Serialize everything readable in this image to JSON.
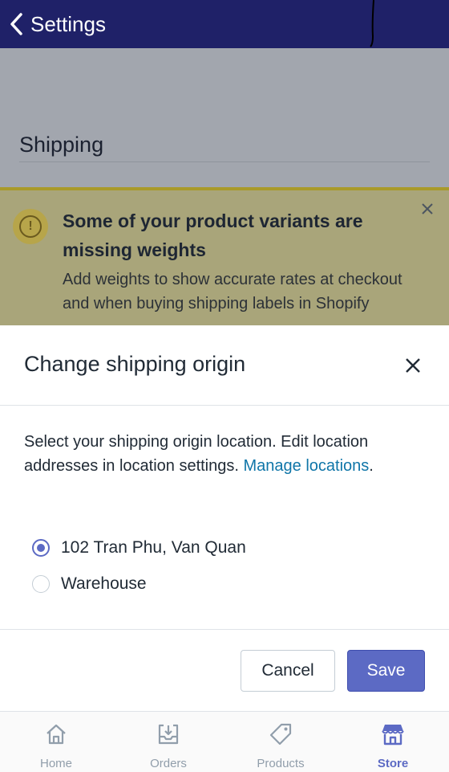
{
  "topbar": {
    "back_label": "Settings"
  },
  "page": {
    "title": "Shipping"
  },
  "banner": {
    "title": "Some of your product variants are missing weights",
    "text": "Add weights to show accurate rates at checkout and when buying shipping labels in Shopify",
    "icon": "warning-icon"
  },
  "sheet": {
    "title": "Change shipping origin",
    "description_prefix": "Select your shipping origin location. Edit location addresses in location settings. ",
    "link_text": "Manage locations",
    "description_suffix": ".",
    "options": [
      {
        "label": "102 Tran Phu, Van Quan",
        "selected": true
      },
      {
        "label": "Warehouse",
        "selected": false
      }
    ],
    "cancel_label": "Cancel",
    "save_label": "Save"
  },
  "tabs": [
    {
      "label": "Home",
      "icon": "home-icon",
      "active": false
    },
    {
      "label": "Orders",
      "icon": "orders-icon",
      "active": false
    },
    {
      "label": "Products",
      "icon": "tag-icon",
      "active": false
    },
    {
      "label": "Store",
      "icon": "store-icon",
      "active": true
    }
  ],
  "colors": {
    "accent": "#5c6ac4",
    "nav": "#1f2168",
    "link": "#0f75a8"
  }
}
